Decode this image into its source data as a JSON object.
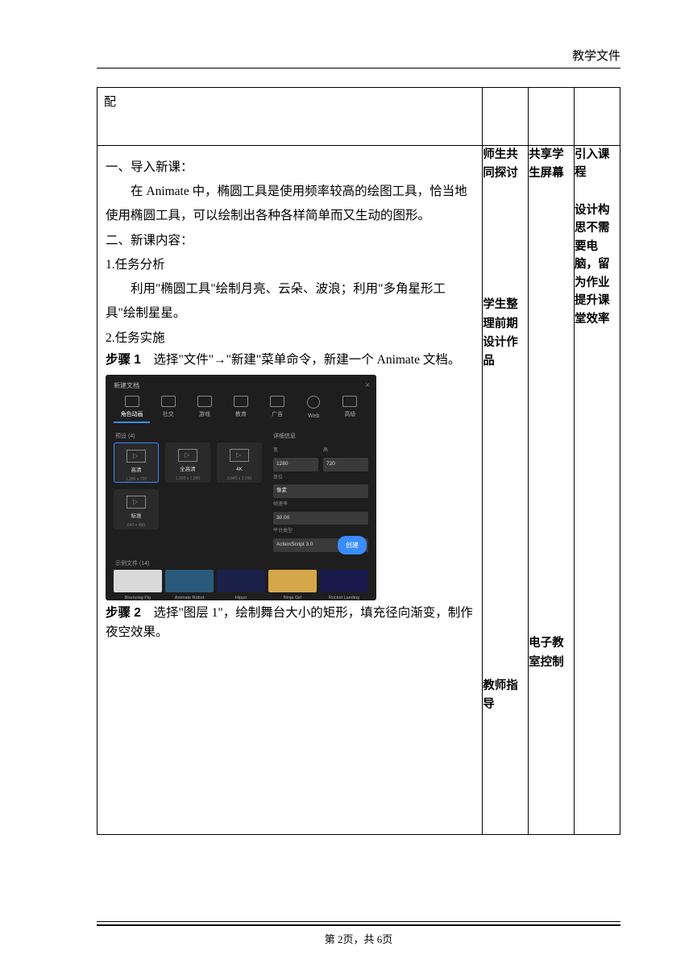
{
  "header": {
    "label": "教学文件"
  },
  "row1": {
    "c1": "配"
  },
  "content": {
    "h1": "一、导入新课：",
    "p1": "在 Animate 中，椭圆工具是使用频率较高的绘图工具，恰当地使用椭圆工具，可以绘制出各种各样简单而又生动的图形。",
    "h2": "二、新课内容：",
    "t1": "1.任务分析",
    "p2": "利用\"椭圆工具\"绘制月亮、云朵、波浪；利用\"多角星形工具\"绘制星星。",
    "t2": "2.任务实施",
    "step1_label": "步骤 1",
    "step1_text": "　选择\"文件\"→\"新建\"菜单命令，新建一个 Animate 文档。",
    "step2_label": "步骤 2",
    "step2_text": "　选择\"图层 1\"，绘制舞台大小的矩形，填充径向渐变，制作夜空效果。"
  },
  "col2": {
    "b1": "师生共同探讨",
    "b2": "学生整理前期设计作品",
    "b3": "教师指导"
  },
  "col3": {
    "b1": "共享学生屏幕",
    "b3": "电子教室控制"
  },
  "col4": {
    "b1": "引入课程",
    "b2": "设计构思不需要电脑，留为作业提升课堂效率"
  },
  "screenshot": {
    "title": "新建文档",
    "tabs": [
      "角色动画",
      "社交",
      "游戏",
      "教育",
      "广告",
      "Web",
      "高级"
    ],
    "presets_label": "预设 (4)",
    "presets": [
      {
        "name": "高清",
        "dim": "1,280 x 720"
      },
      {
        "name": "全高清",
        "dim": "1,920 x 1,080"
      },
      {
        "name": "4K",
        "dim": "3,840 x 2,160"
      },
      {
        "name": "标准",
        "dim": "640 x 480"
      }
    ],
    "details": {
      "title": "详细信息",
      "width_label": "宽",
      "width": "1280",
      "height_label": "高",
      "height": "720",
      "unit_label": "单位",
      "unit": "像素",
      "fps_label": "帧速率",
      "fps": "30.00",
      "platform_label": "平台类型",
      "platform": "ActionScript 3.0"
    },
    "create": "创建",
    "samples_label": "示例文件 (14)",
    "samples": [
      {
        "name": "Bouncing Pig",
        "bg": "#d9d9d9"
      },
      {
        "name": "Animate Robot",
        "bg": "#2a5a7a"
      },
      {
        "name": "Hippo",
        "bg": "#1a2048"
      },
      {
        "name": "Ninja Girl",
        "bg": "#d4a84a"
      },
      {
        "name": "Rocket Landing",
        "bg": "#1a1a4a"
      }
    ]
  },
  "footer": {
    "text": "第 2页，共 6页"
  }
}
